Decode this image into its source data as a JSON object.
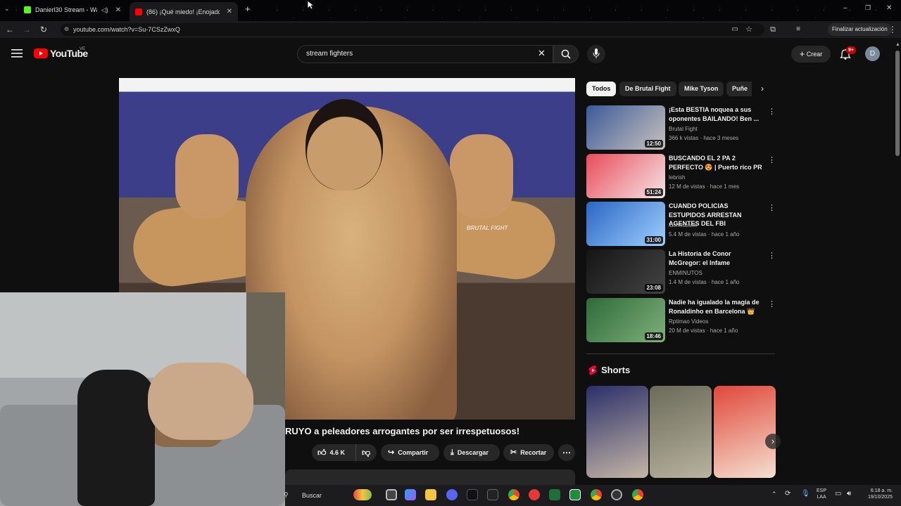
{
  "browser": {
    "tabs": [
      {
        "label": "Danierl30 Stream - Watch Li",
        "favicon_color": "#53fc18"
      },
      {
        "label": "(86) ¡Qué miedo! ¡Enojado Mike",
        "favicon_color": "#ff0000"
      }
    ],
    "url": "youtube.com/watch?v=Su-7CSzZwxQ",
    "update_label": "Finalizar actualización",
    "profile_initial": "D"
  },
  "youtube": {
    "logo_text": "YouTube",
    "region": "VE",
    "search_value": "stream fighters",
    "create_label": "Crear",
    "notif_badge": "9+",
    "avatar_initial": "D"
  },
  "video": {
    "watermark": "BRUTAL FIGHT",
    "title": "RUYO a peleadores arrogantes por ser irrespetuosos!",
    "like_count": "4.6 K",
    "share_label": "Compartir",
    "download_label": "Descargar",
    "clip_label": "Recortar"
  },
  "chips": [
    "Todos",
    "De Brutal Fight",
    "Mike Tyson",
    "Puñe"
  ],
  "recommendations": [
    {
      "title": "¡Esta BESTIA noquea a sus oponentes BAILANDO! Ben ...",
      "channel": "Brutal Fight",
      "meta": "366 k vistas · hace 3 meses",
      "duration": "12:50",
      "colors": [
        "#3b5a9a",
        "#c9c2bd"
      ]
    },
    {
      "title": "BUSCANDO EL 2 PA 2 PERFECTO 😍 | Puerto rico PR",
      "channel": "lebrish",
      "meta": "12 M de vistas · hace 1 mes",
      "duration": "51:24",
      "colors": [
        "#e94b5a",
        "#f5e6e6"
      ]
    },
    {
      "title": "CUANDO POLICIAS ESTUPIDOS ARRESTAN AGENTES DEL FBI",
      "channel": "luchosback",
      "meta": "5.4 M de vistas · hace 1 año",
      "duration": "31:00",
      "colors": [
        "#2a66c4",
        "#9fd0ff"
      ]
    },
    {
      "title": "La Historia de Conor McGregor: el Infame",
      "channel": "ENMINUTOS",
      "meta": "1.4 M de vistas · hace 1 año",
      "duration": "23:08",
      "colors": [
        "#151515",
        "#444444"
      ]
    },
    {
      "title": "Nadie ha igualado la magia de Ronaldinho en Barcelona 👑",
      "channel": "Rptimao Videos",
      "meta": "20 M de vistas · hace 1 año",
      "duration": "18:46",
      "colors": [
        "#2e6b3a",
        "#7fb07a"
      ]
    }
  ],
  "shorts": {
    "title": "Shorts",
    "items": [
      {
        "colors": [
          "#2b2f6a",
          "#c4b6a6"
        ]
      },
      {
        "colors": [
          "#6b6a58",
          "#b8b2a0"
        ]
      },
      {
        "colors": [
          "#e0473a",
          "#f5e0d0"
        ]
      }
    ]
  },
  "taskbar": {
    "search_label": "Buscar",
    "lang_line1": "ESP",
    "lang_line2": "LAA",
    "time": "6:18 a. m.",
    "date": "19/10/2025"
  }
}
